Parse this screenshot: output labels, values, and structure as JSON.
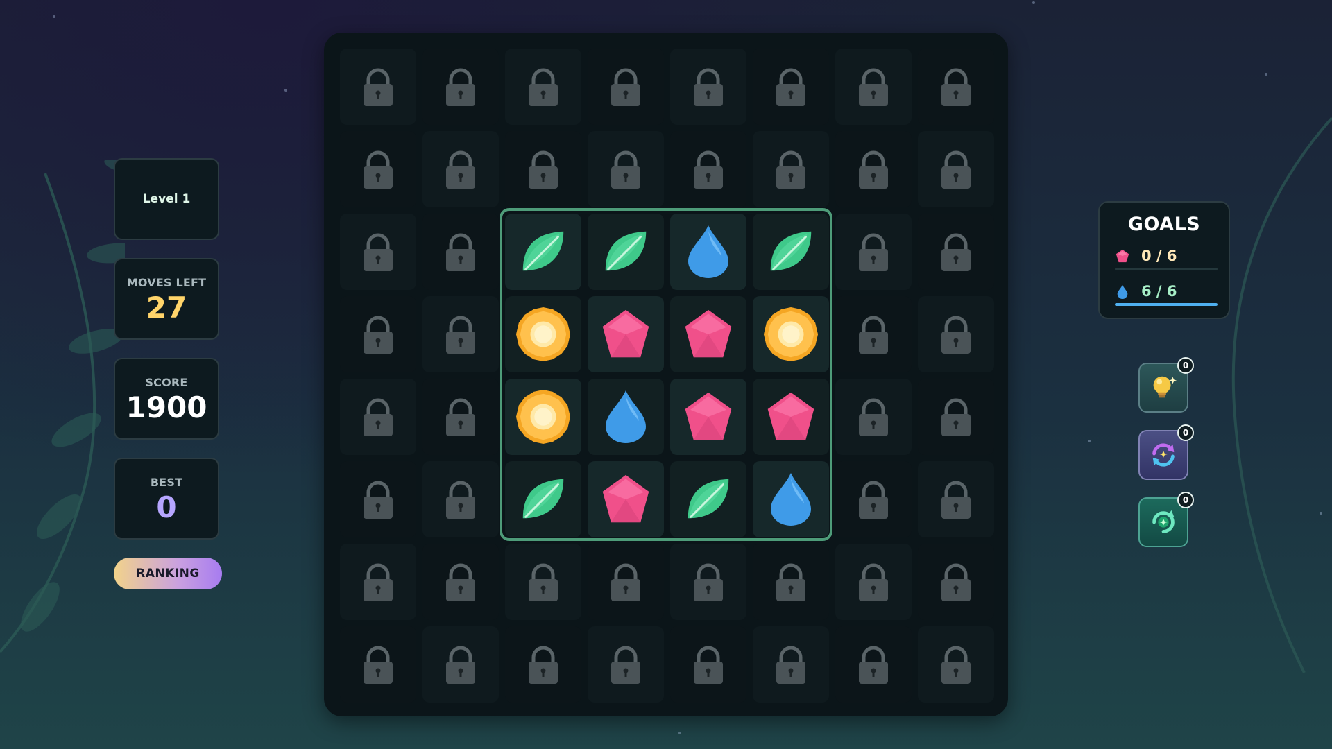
{
  "stats": {
    "level": "Level 1",
    "moves_label": "MOVES LEFT",
    "moves_value": "27",
    "score_label": "SCORE",
    "score_value": "1900",
    "best_label": "BEST",
    "best_value": "0"
  },
  "ranking_label": "RANKING",
  "goals": {
    "title": "GOALS",
    "items": [
      {
        "icon": "gem-icon",
        "text": "0 / 6",
        "progress": 0,
        "text_color": "#ffe8b8"
      },
      {
        "icon": "drop-icon",
        "text": "6 / 6",
        "progress": 1,
        "text_color": "#a8f0c8"
      }
    ]
  },
  "powerups": [
    {
      "name": "hint-powerup",
      "icon": "lightbulb-icon",
      "count": "0"
    },
    {
      "name": "swap-powerup",
      "icon": "swap-arrows-icon",
      "count": "0"
    },
    {
      "name": "shuffle-powerup",
      "icon": "shuffle-icon",
      "count": "0"
    }
  ],
  "board": {
    "rows": 8,
    "cols": 8,
    "grid": [
      [
        "L",
        "L",
        "L",
        "L",
        "L",
        "L",
        "L",
        "L"
      ],
      [
        "L",
        "L",
        "L",
        "L",
        "L",
        "L",
        "L",
        "L"
      ],
      [
        "L",
        "L",
        "leaf",
        "leaf",
        "drop",
        "leaf",
        "L",
        "L"
      ],
      [
        "L",
        "L",
        "coin",
        "gem",
        "gem",
        "coin",
        "L",
        "L"
      ],
      [
        "L",
        "L",
        "coin",
        "drop",
        "gem",
        "gem",
        "L",
        "L"
      ],
      [
        "L",
        "L",
        "leaf",
        "gem",
        "leaf",
        "drop",
        "L",
        "L"
      ],
      [
        "L",
        "L",
        "L",
        "L",
        "L",
        "L",
        "L",
        "L"
      ],
      [
        "L",
        "L",
        "L",
        "L",
        "L",
        "L",
        "L",
        "L"
      ]
    ]
  },
  "colors": {
    "leaf": "#3fc98a",
    "gem": "#f0508a",
    "drop": "#3f9be8",
    "coin": "#f5a623",
    "active_border": "#4e9c79"
  }
}
